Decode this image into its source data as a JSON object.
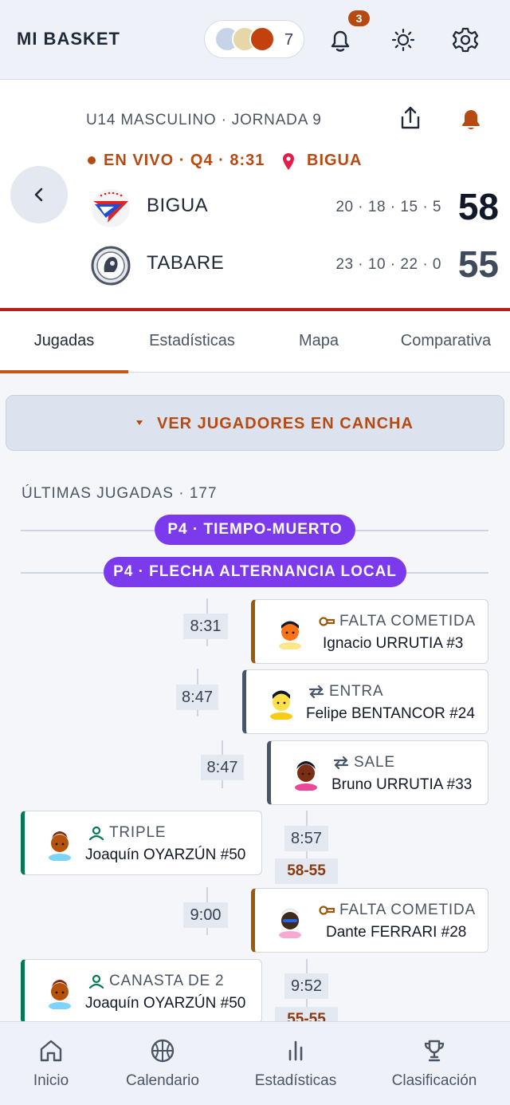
{
  "app": {
    "brand": "MI BASKET",
    "followers_count": "7",
    "notifications_count": "3"
  },
  "game": {
    "meta": "U14 MASCULINO · JORNADA 9",
    "live_status": "EN VIVO · Q4 · 8:31",
    "venue": "BIGUA",
    "home": {
      "name": "BIGUA",
      "quarters": "20 · 18 · 15 · 5",
      "score": "58"
    },
    "away": {
      "name": "TABARE",
      "quarters": "23 · 10 · 22 · 0",
      "score": "55"
    }
  },
  "tabs": [
    "Jugadas",
    "Estadísticas",
    "Mapa",
    "Comparativa"
  ],
  "on_court_toggle": "VER JUGADORES EN CANCHA",
  "plays_header": "ÚLTIMAS JUGADAS · 177",
  "markers": [
    "P4 · TIEMPO-MUERTO",
    "P4 · FLECHA ALTERNANCIA LOCAL"
  ],
  "plays": [
    {
      "time": "8:31",
      "type": "FALTA COMETIDA",
      "player": "Ignacio URRUTIA #3",
      "icon": "whistle-icon",
      "side": "away"
    },
    {
      "time": "8:47",
      "type": "ENTRA",
      "player": "Felipe BENTANCOR #24",
      "icon": "swap-icon",
      "side": "away"
    },
    {
      "time": "8:47",
      "type": "SALE",
      "player": "Bruno URRUTIA #33",
      "icon": "swap-icon",
      "side": "away"
    },
    {
      "time": "8:57",
      "type": "TRIPLE",
      "player": "Joaquín OYARZÚN #50",
      "icon": "person-icon",
      "side": "home",
      "score": "58-55"
    },
    {
      "time": "9:00",
      "type": "FALTA COMETIDA",
      "player": "Dante FERRARI #28",
      "icon": "whistle-icon",
      "side": "away"
    },
    {
      "time": "9:52",
      "type": "CANASTA DE 2",
      "player": "Joaquín OYARZÚN #50",
      "icon": "person-icon",
      "side": "home",
      "score": "55-55"
    }
  ],
  "bottom_nav": [
    "Inicio",
    "Calendario",
    "Estadísticas",
    "Clasificación"
  ],
  "colors": {
    "accent": "#b64a12",
    "live_red": "#b91c1c",
    "marker_purple": "#7c3aed",
    "score_green": "#047857"
  }
}
